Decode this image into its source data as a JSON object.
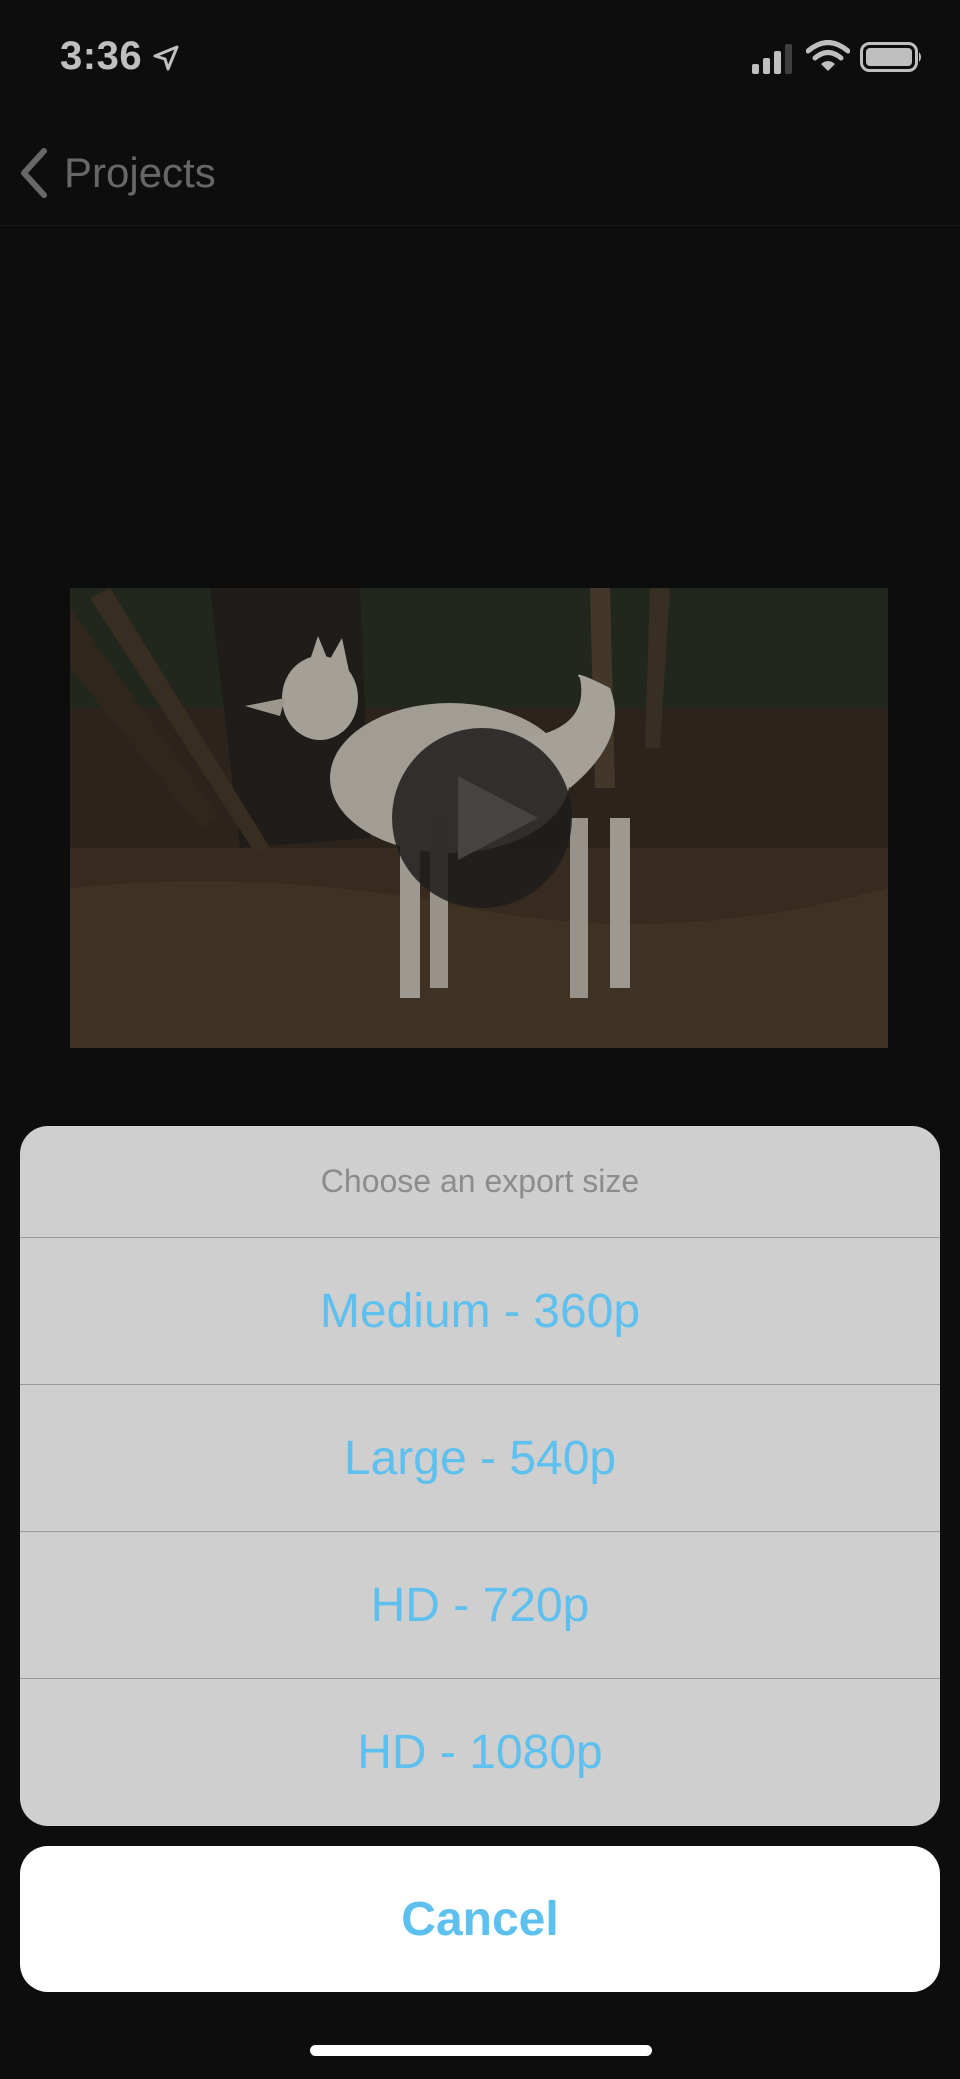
{
  "status_bar": {
    "time": "3:36",
    "icons": [
      "location-arrow-icon",
      "cellular-signal-icon",
      "wifi-icon",
      "battery-icon"
    ]
  },
  "nav": {
    "back_label": "Projects",
    "back_icon": "chevron-left-icon"
  },
  "video": {
    "thumbnail": "white dog standing by a tree in a forest",
    "play_icon": "play-icon"
  },
  "action_sheet": {
    "title": "Choose an export size",
    "options": [
      "Medium - 360p",
      "Large - 540p",
      "HD - 720p",
      "HD - 1080p"
    ],
    "cancel_label": "Cancel"
  },
  "colors": {
    "background": "#121212",
    "accent": "#5ec0ee",
    "sheet_bg": "#cfcfcf",
    "title_text": "#8c8c8c"
  }
}
